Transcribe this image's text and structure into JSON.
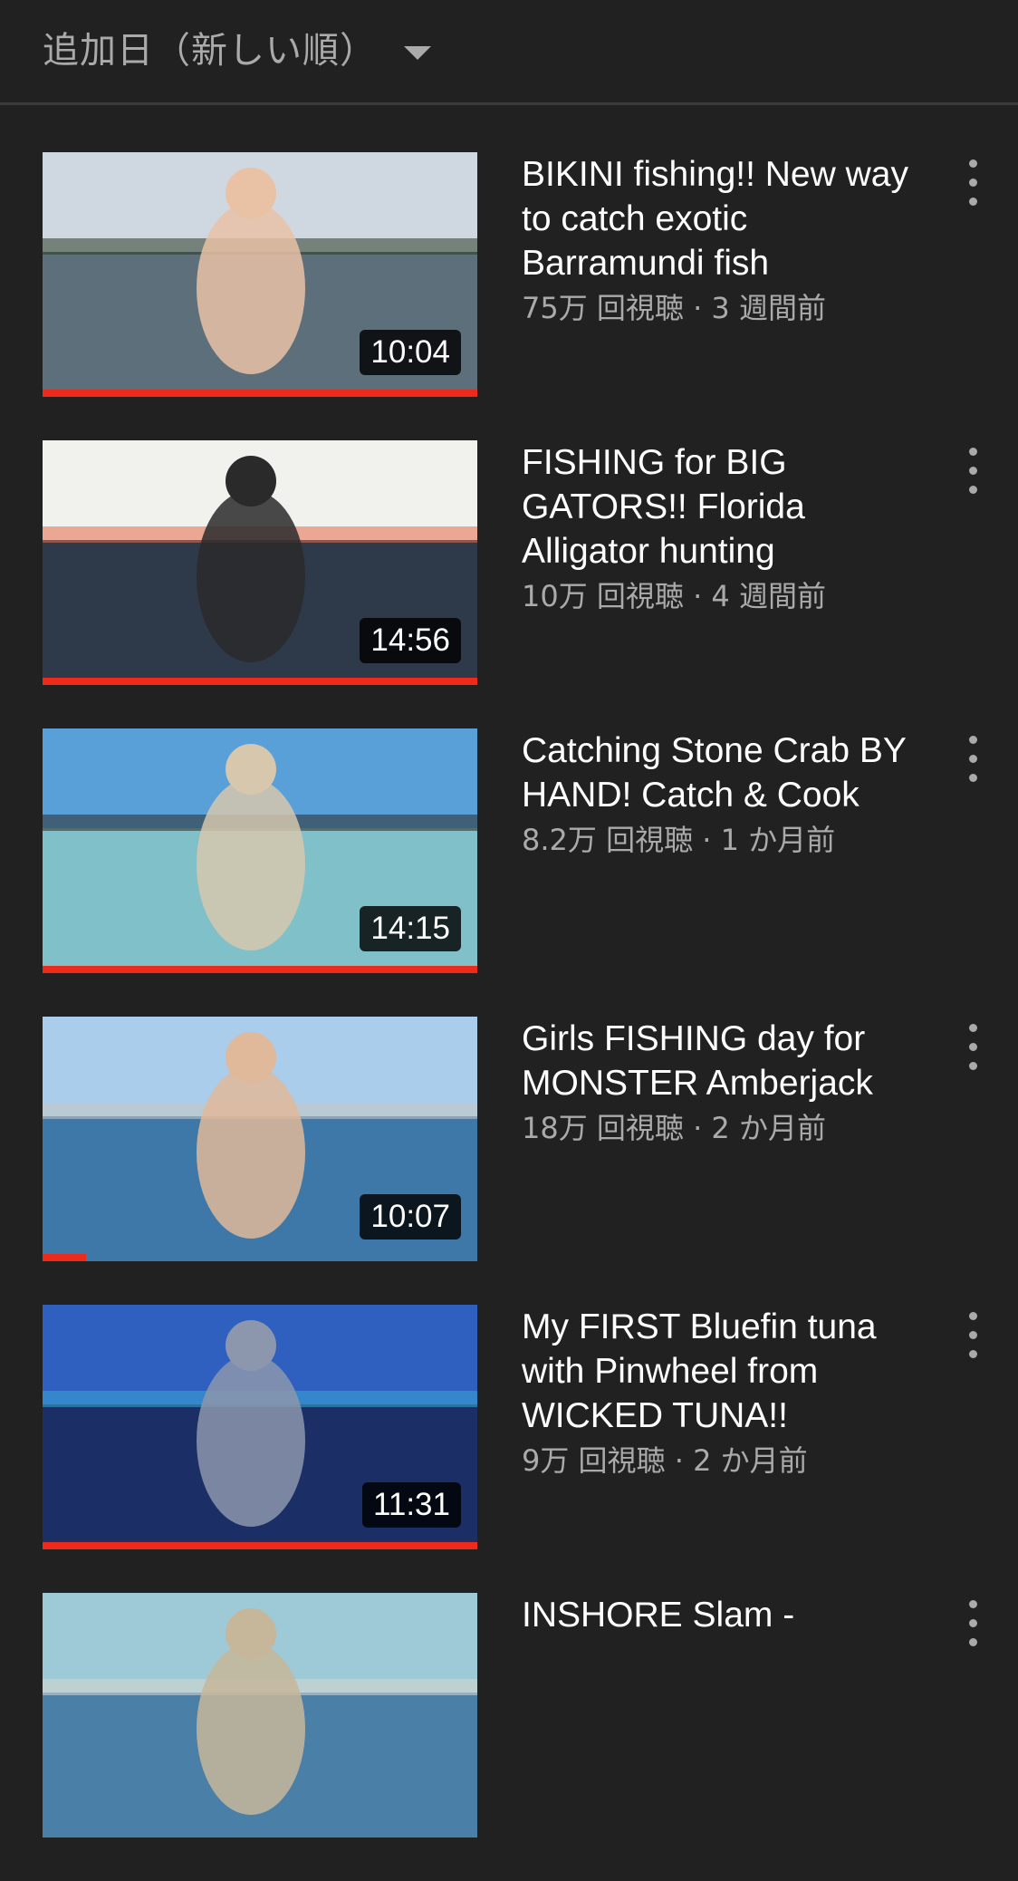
{
  "sort": {
    "label": "追加日（新しい順）",
    "icon": "dropdown-caret-icon"
  },
  "videos": [
    {
      "title": "BIKINI fishing!! New way to catch exotic Barramundi fish",
      "views": "75万 回視聴",
      "age": "3 週間前",
      "duration": "10:04",
      "watched_fraction": 1.0,
      "thumb_palette": [
        "#cfd8e0",
        "#5d6f7a",
        "#2c3c2a",
        "#e9c2a6"
      ]
    },
    {
      "title": "FISHING for BIG GATORS!! Florida Alligator hunting",
      "views": "10万 回視聴",
      "age": "4 週間前",
      "duration": "14:56",
      "watched_fraction": 1.0,
      "thumb_palette": [
        "#f1f1ee",
        "#2e3a4a",
        "#e26a4a",
        "#2a2a2a"
      ]
    },
    {
      "title": "Catching Stone Crab BY HAND! Catch & Cook",
      "views": "8.2万 回視聴",
      "age": "1 か月前",
      "duration": "14:15",
      "watched_fraction": 1.0,
      "thumb_palette": [
        "#5aa0d8",
        "#7fc0c9",
        "#2b2b2b",
        "#d6c7ad"
      ]
    },
    {
      "title": "Girls FISHING day for MONSTER Amberjack",
      "views": "18万 回視聴",
      "age": "2 か月前",
      "duration": "10:07",
      "watched_fraction": 0.1,
      "thumb_palette": [
        "#a9cdea",
        "#3d78a8",
        "#c9c9c2",
        "#e0b89a"
      ]
    },
    {
      "title": "My FIRST Bluefin tuna with Pinwheel from WICKED TUNA!!",
      "views": "9万 回視聴",
      "age": "2 か月前",
      "duration": "11:31",
      "watched_fraction": 1.0,
      "thumb_palette": [
        "#2f5fbf",
        "#1b2f66",
        "#3aa7d6",
        "#8c97ad"
      ]
    },
    {
      "title": "INSHORE Slam -",
      "views": "",
      "age": "",
      "duration": "",
      "watched_fraction": 0,
      "thumb_palette": [
        "#9ec9d6",
        "#4a7fa8",
        "#d7d7d0",
        "#c6b79a"
      ]
    }
  ],
  "meta_separator": " · ",
  "more_icon": "more-vertical-icon",
  "progress_color": "#ee2b1b"
}
